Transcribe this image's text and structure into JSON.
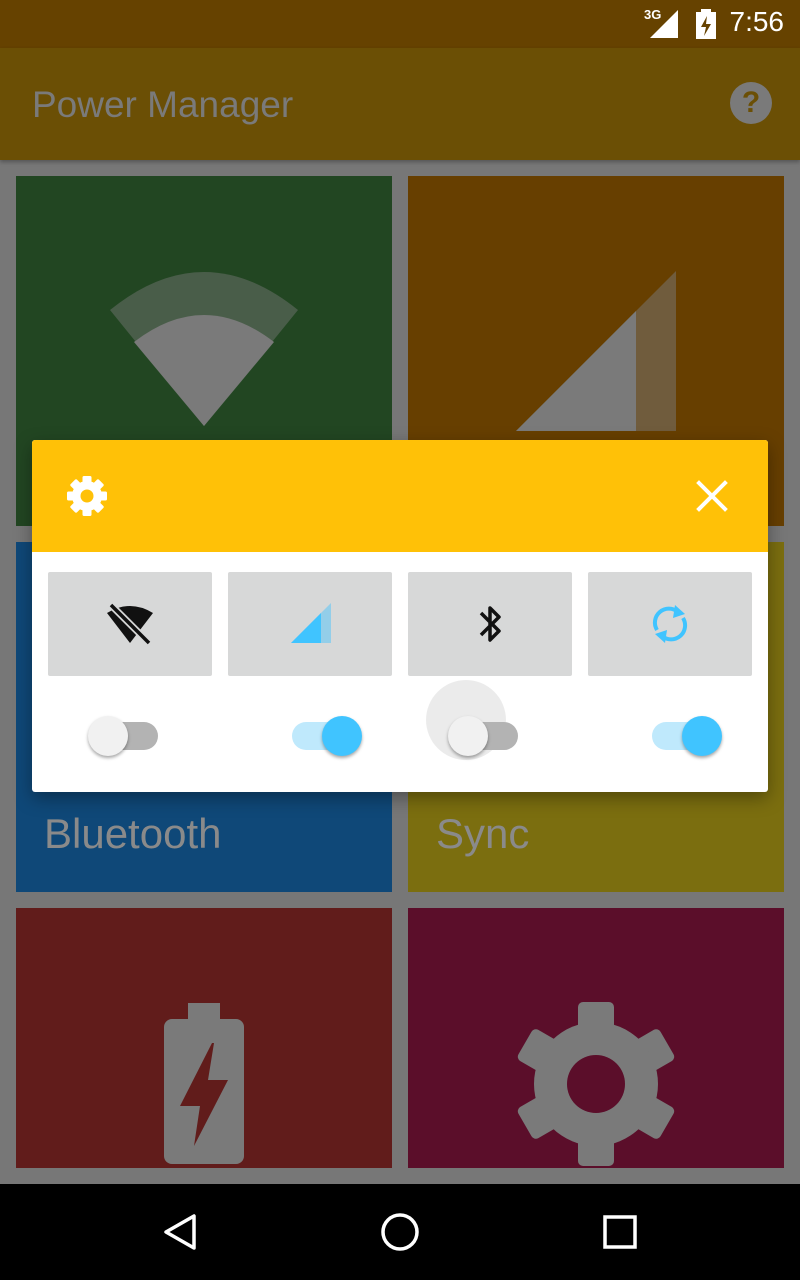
{
  "status_bar": {
    "time": "7:56",
    "network": "3G"
  },
  "app_bar": {
    "title": "Power Manager",
    "help_icon": "?"
  },
  "tiles": [
    {
      "name": "wifi",
      "label": "",
      "icon": "wifi-icon",
      "color": "#224622"
    },
    {
      "name": "mobile-data",
      "label": "",
      "icon": "signal-icon",
      "color": "#673f00"
    },
    {
      "name": "bluetooth",
      "label": "Bluetooth",
      "icon": "bluetooth-icon",
      "color": "#0f4878"
    },
    {
      "name": "sync",
      "label": "Sync",
      "icon": "sync-icon",
      "color": "#7b6e0f"
    },
    {
      "name": "battery",
      "label": "",
      "icon": "battery-charging-icon",
      "color": "#611c1b"
    },
    {
      "name": "settings",
      "label": "",
      "icon": "gear-icon",
      "color": "#5b0e2a"
    }
  ],
  "dialog": {
    "header_color": "#ffc107",
    "header_icon": "gear-icon",
    "close_icon": "close-icon",
    "quick_buttons": [
      {
        "name": "wifi-off",
        "icon": "wifi-off-icon"
      },
      {
        "name": "mobile-signal",
        "icon": "signal-icon"
      },
      {
        "name": "bluetooth",
        "icon": "bluetooth-icon"
      },
      {
        "name": "sync",
        "icon": "sync-icon"
      }
    ],
    "toggles": [
      {
        "name": "wifi-toggle",
        "on": false
      },
      {
        "name": "mobile-data-toggle",
        "on": true
      },
      {
        "name": "bluetooth-toggle",
        "on": false
      },
      {
        "name": "sync-toggle",
        "on": true
      }
    ],
    "accent_color": "#40c4ff"
  },
  "nav_bar": {
    "buttons": [
      "back-icon",
      "home-icon",
      "recents-icon"
    ]
  }
}
